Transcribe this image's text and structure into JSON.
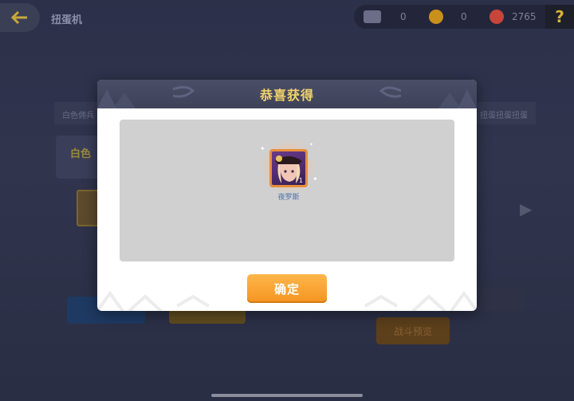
{
  "header": {
    "title": "扭蛋机"
  },
  "currencies": [
    {
      "icon": "ticket-icon",
      "value": "0",
      "color": "#6b6e86"
    },
    {
      "icon": "gold-coin-icon",
      "value": "0",
      "color": "#c9901c"
    },
    {
      "icon": "red-gem-icon",
      "value": "2765",
      "color": "#c8453a"
    }
  ],
  "help_label": "?",
  "background": {
    "strip_left": "白色佣兵",
    "strip_right": "扭蛋扭蛋扭蛋",
    "card_name": "白色",
    "btn_war_label": "战斗预览"
  },
  "modal": {
    "title": "恭喜获得",
    "reward": {
      "name": "夜罗斯",
      "count": "1",
      "rarity_color": "#e88e3a"
    },
    "confirm_label": "确定"
  }
}
